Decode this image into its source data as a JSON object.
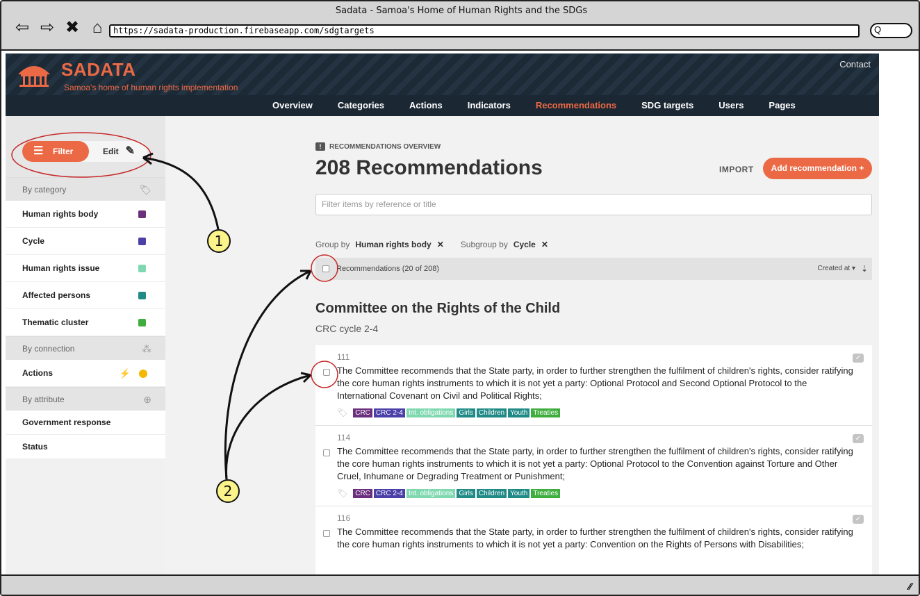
{
  "browser": {
    "title": "Sadata - Samoa's Home of Human Rights and the SDGs",
    "url": "https://sadata-production.firebaseapp.com/sdgtargets",
    "search_glyph": "Q"
  },
  "header": {
    "brand": "SADATA",
    "tagline": "Samoa's home of human rights implementation",
    "contact": "Contact",
    "nav": [
      "Overview",
      "Categories",
      "Actions",
      "Indicators",
      "Recommendations",
      "SDG targets",
      "Users",
      "Pages"
    ],
    "active_nav": "Recommendations",
    "brand_color": "#ec6945",
    "bg_color": "#1f2d3a"
  },
  "sidebar": {
    "filter_label": "Filter",
    "edit_label": "Edit",
    "by_category": "By category",
    "categories": [
      {
        "label": "Human rights body",
        "color": "#6b2f7d"
      },
      {
        "label": "Cycle",
        "color": "#4b3fa8"
      },
      {
        "label": "Human rights issue",
        "color": "#7fd8b0"
      },
      {
        "label": "Affected persons",
        "color": "#1f8a86"
      },
      {
        "label": "Thematic cluster",
        "color": "#3fae3f"
      }
    ],
    "by_connection": "By connection",
    "connections": [
      {
        "label": "Actions",
        "color": "#f5b800"
      }
    ],
    "by_attribute": "By attribute",
    "attributes": [
      "Government response",
      "Status"
    ]
  },
  "main": {
    "overview_label": "RECOMMENDATIONS OVERVIEW",
    "title": "208 Recommendations",
    "import_label": "IMPORT",
    "add_label": "Add recommendation +",
    "search_placeholder": "Filter items by reference or title",
    "group_by_label": "Group by",
    "group_by_value": "Human rights body",
    "subgroup_by_label": "Subgroup by",
    "subgroup_by_value": "Cycle",
    "list_count": "Recommendations (20 of 208)",
    "sort_label": "Created at",
    "group_title": "Committee on the Rights of the Child",
    "group_subtitle": "CRC cycle 2-4",
    "records": [
      {
        "ref": "111",
        "text": "The Committee recommends that the State party, in order to further strengthen the fulfilment of children's rights, consider ratifying the core human rights instruments to which it is not yet a party: Optional Protocol and Second Optional Protocol to the International Covenant on Civil and Political Rights;"
      },
      {
        "ref": "114",
        "text": "The Committee recommends that the State party, in order to further strengthen the fulfilment of children's rights, consider ratifying the core human rights instruments to which it is not yet a party: Optional Protocol to the Convention against Torture and Other Cruel, Inhumane or Degrading Treatment or Punishment;"
      },
      {
        "ref": "116",
        "text": "The Committee recommends that the State party, in order to further strengthen the fulfilment of children's rights, consider ratifying the core human rights instruments to which it is not yet a party: Convention on the Rights of Persons with Disabilities;"
      }
    ],
    "tags": [
      {
        "label": "CRC",
        "color": "#6b2f7d"
      },
      {
        "label": "CRC 2-4",
        "color": "#4b3fa8"
      },
      {
        "label": "Int. obligations",
        "color": "#7fd8b0"
      },
      {
        "label": "Girls",
        "color": "#1f8a86"
      },
      {
        "label": "Children",
        "color": "#1f8a86"
      },
      {
        "label": "Youth",
        "color": "#1f8a86"
      },
      {
        "label": "Treaties",
        "color": "#3fae3f"
      }
    ]
  },
  "annotations": {
    "badge1": "1",
    "badge2": "2"
  }
}
